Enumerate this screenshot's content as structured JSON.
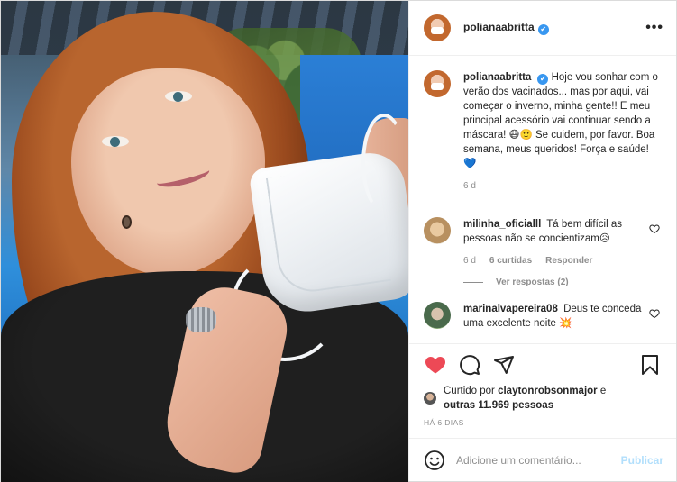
{
  "post": {
    "username": "polianaabritta",
    "verified": true,
    "more_label": "•••"
  },
  "caption": {
    "username": "polianaabritta",
    "text": "Hoje vou sonhar com o verão dos vacinados... mas por aqui, vai começar o inverno, minha gente!! E meu principal acessório vai continuar sendo a máscara! 😷🙂 Se cuidem, por favor. Boa semana, meus queridos! Força e saúde! 💙",
    "time": "6 d"
  },
  "comments": [
    {
      "username": "milinha_oficialll",
      "text": "Tá bem difícil as pessoas não se concientizam😥",
      "time": "6 d",
      "likes": "6 curtidas",
      "reply_label": "Responder",
      "view_replies": "Ver respostas (2)"
    },
    {
      "username": "marinalvapereira08",
      "text": "Deus te conceda uma excelente noite 💥"
    }
  ],
  "likes": {
    "prefix": "Curtido por",
    "user": "claytonrobsonmajor",
    "and": "e",
    "others": "outras 11.969 pessoas"
  },
  "timestamp": "Há 6 dias",
  "add_comment": {
    "placeholder": "Adicione um comentário...",
    "publish_label": "Publicar"
  },
  "colors": {
    "like_active": "#ed4956",
    "verified": "#3897f0",
    "publish_disabled": "#b2dffc",
    "muted": "#8e8e8e"
  },
  "icons": [
    "heart-icon",
    "comment-icon",
    "share-icon",
    "bookmark-icon",
    "emoji-icon",
    "heart-outline-icon",
    "verified-icon"
  ]
}
